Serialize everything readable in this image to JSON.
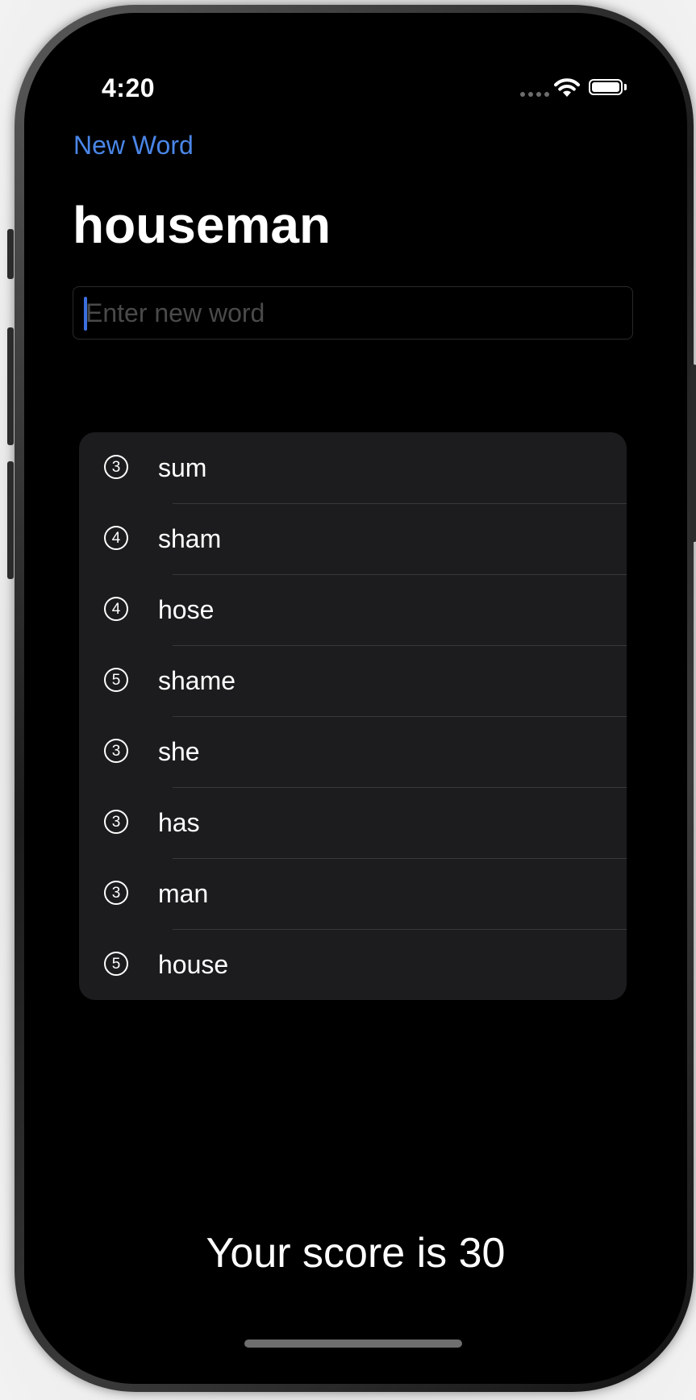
{
  "status_bar": {
    "time": "4:20",
    "icons": [
      "signal-dots-icon",
      "wifi-icon",
      "battery-icon"
    ]
  },
  "nav": {
    "new_word_label": "New Word"
  },
  "root_word": "houseman",
  "input": {
    "value": "",
    "placeholder": "Enter new word"
  },
  "used_words": [
    {
      "count": "3",
      "word": "sum"
    },
    {
      "count": "4",
      "word": "sham"
    },
    {
      "count": "4",
      "word": "hose"
    },
    {
      "count": "5",
      "word": "shame"
    },
    {
      "count": "3",
      "word": "she"
    },
    {
      "count": "3",
      "word": "has"
    },
    {
      "count": "3",
      "word": "man"
    },
    {
      "count": "5",
      "word": "house"
    }
  ],
  "score_text": "Your score is 30",
  "colors": {
    "accent": "#4a86e8",
    "background": "#000000",
    "list_background": "#1c1c1e",
    "separator": "#38383a"
  }
}
